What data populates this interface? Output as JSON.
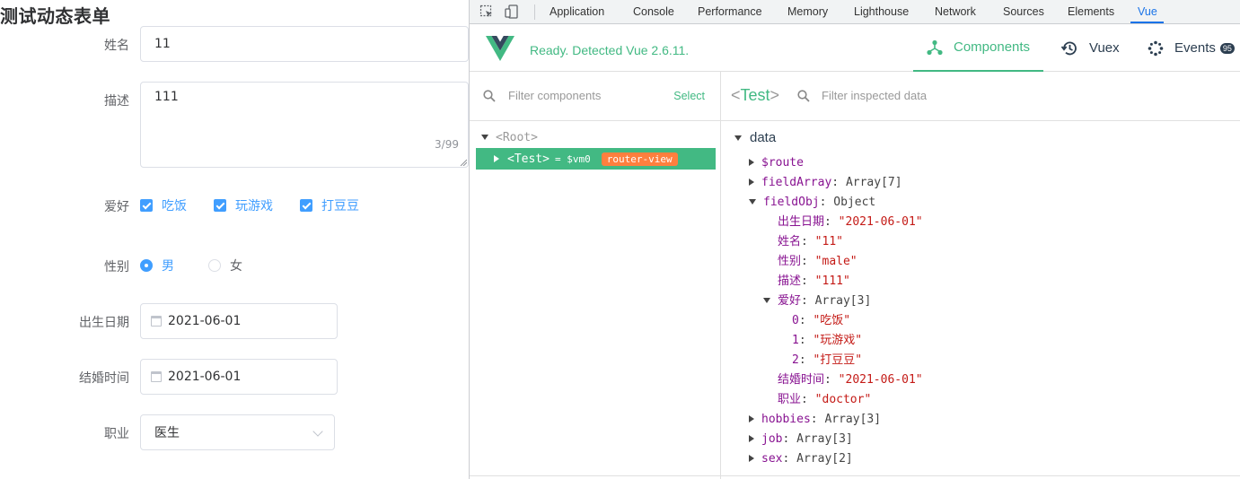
{
  "form": {
    "title": "测试动态表单",
    "name": {
      "label": "姓名",
      "value": "11"
    },
    "description": {
      "label": "描述",
      "value": "111",
      "counter": "3/99"
    },
    "hobbies": {
      "label": "爱好",
      "options": [
        "吃饭",
        "玩游戏",
        "打豆豆"
      ]
    },
    "gender": {
      "label": "性别",
      "options": [
        "男",
        "女"
      ],
      "selected": "男"
    },
    "birth_date": {
      "label": "出生日期",
      "value": "2021-06-01"
    },
    "marry_time": {
      "label": "结婚时间",
      "value": "2021-06-01"
    },
    "job": {
      "label": "职业",
      "value": "医生"
    }
  },
  "devtools": {
    "tabs": [
      "Application",
      "Console",
      "Performance",
      "Memory",
      "Lighthouse",
      "Network",
      "Sources",
      "Elements",
      "Vue"
    ],
    "active_tab": "Vue",
    "icons": [
      "inspect-element-icon",
      "device-toolbar-icon"
    ],
    "accent_color": "#1a73e8"
  },
  "vue": {
    "status": "Ready. Detected Vue 2.6.11.",
    "brand_color": "#42b983",
    "tabs": [
      {
        "label": "Components",
        "icon": "components-icon",
        "active": true
      },
      {
        "label": "Vuex",
        "icon": "history-icon",
        "active": false
      },
      {
        "label": "Events",
        "icon": "events-icon",
        "active": false,
        "badge": "95"
      }
    ],
    "tree": {
      "filter_placeholder": "Filter components",
      "select_label": "Select",
      "root": "<Root>",
      "selected": {
        "name": "<Test>",
        "vm": "= $vm0",
        "tag": "router-view"
      }
    },
    "inspector": {
      "component_name": "Test",
      "filter_placeholder": "Filter inspected data",
      "section": "data",
      "rows": [
        {
          "key": "$route",
          "value": "",
          "expand": "collapsed",
          "indent": 0
        },
        {
          "key": "fieldArray",
          "value": "Array[7]",
          "expand": "collapsed",
          "indent": 0
        },
        {
          "key": "fieldObj",
          "value": "Object",
          "expand": "expanded",
          "indent": 0
        },
        {
          "key": "出生日期",
          "value": "\"2021-06-01\"",
          "type": "string",
          "indent": 1
        },
        {
          "key": "姓名",
          "value": "\"11\"",
          "type": "string",
          "indent": 1
        },
        {
          "key": "性别",
          "value": "\"male\"",
          "type": "string",
          "indent": 1
        },
        {
          "key": "描述",
          "value": "\"111\"",
          "type": "string",
          "indent": 1
        },
        {
          "key": "爱好",
          "value": "Array[3]",
          "expand": "expanded",
          "indent": 1
        },
        {
          "key": "0",
          "value": "\"吃饭\"",
          "type": "string",
          "indent": 2
        },
        {
          "key": "1",
          "value": "\"玩游戏\"",
          "type": "string",
          "indent": 2
        },
        {
          "key": "2",
          "value": "\"打豆豆\"",
          "type": "string",
          "indent": 2
        },
        {
          "key": "结婚时间",
          "value": "\"2021-06-01\"",
          "type": "string",
          "indent": 1
        },
        {
          "key": "职业",
          "value": "\"doctor\"",
          "type": "string",
          "indent": 1
        },
        {
          "key": "hobbies",
          "value": "Array[3]",
          "expand": "collapsed",
          "indent": 0
        },
        {
          "key": "job",
          "value": "Array[3]",
          "expand": "collapsed",
          "indent": 0
        },
        {
          "key": "sex",
          "value": "Array[2]",
          "expand": "collapsed",
          "indent": 0
        }
      ]
    }
  }
}
